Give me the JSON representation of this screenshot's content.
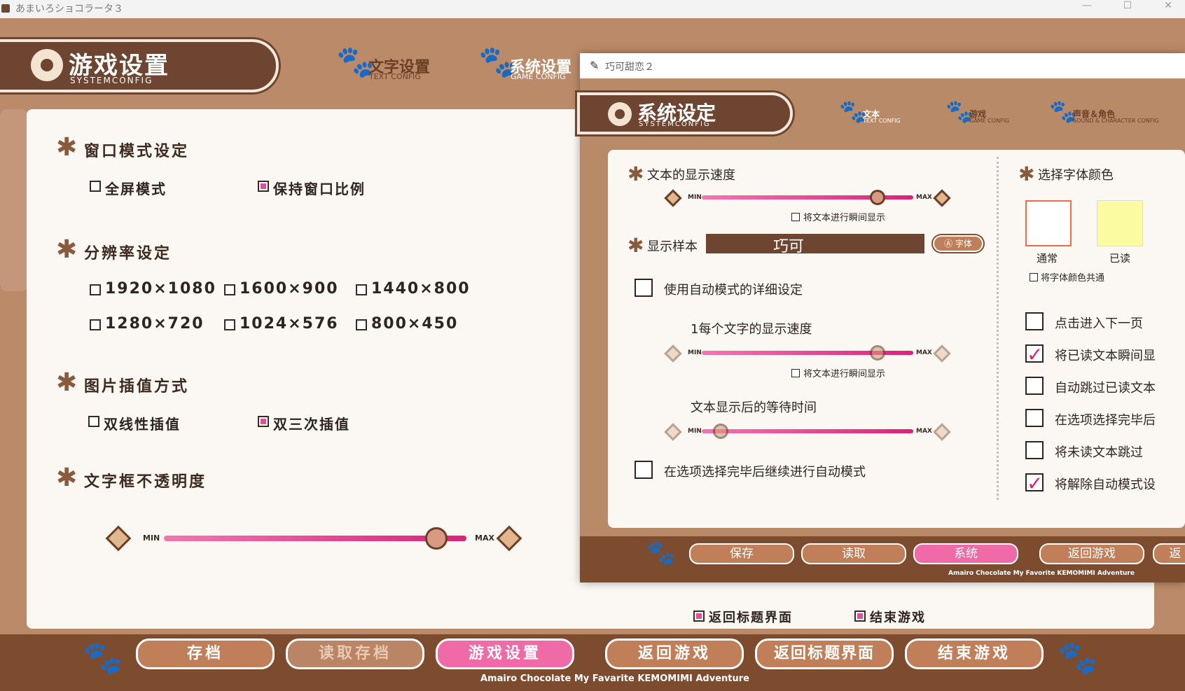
{
  "window": {
    "title": "あまいろショコラータ３",
    "min": "—",
    "max": "☐",
    "close": "✕"
  },
  "header": {
    "title": "游戏设置",
    "subtitle": "SYSTEMCONFIG",
    "tabs": [
      {
        "label": "文字设置",
        "sub": "TEXT CONFIG"
      },
      {
        "label": "系统设置",
        "sub": "GAME CONFIG"
      }
    ]
  },
  "sections": {
    "window_mode": {
      "title": "窗口模式设定",
      "options": [
        "全屏模式",
        "保持窗口比例"
      ],
      "selected": 1
    },
    "resolution": {
      "title": "分辨率设定",
      "options": [
        "1920×1080",
        "1600×900",
        "1440×800",
        "1280×720",
        "1024×576",
        "800×450"
      ]
    },
    "interpolation": {
      "title": "图片插值方式",
      "options": [
        "双线性插值",
        "双三次插值"
      ],
      "selected": 1
    },
    "opacity": {
      "title": "文字框不透明度",
      "min": "MIN",
      "max": "MAX",
      "value": 0.9
    }
  },
  "hidden_options": {
    "return_title": "返回标题界面",
    "end_game": "结束游戏"
  },
  "bottom": {
    "buttons": [
      "存档",
      "读取存档",
      "游戏设置",
      "返回游戏",
      "返回标题界面",
      "结束游戏"
    ],
    "footer": "Amairo Chocolate My Favarite KEMOMIMI Adventure"
  },
  "overlay": {
    "title": "巧可甜恋２",
    "header": {
      "title": "系统设定",
      "subtitle": "SYSTEMCONFIG"
    },
    "tabs": [
      {
        "label": "文本",
        "sub": "TEXT CONFIG"
      },
      {
        "label": "游戏",
        "sub": "GAME CONFIG"
      },
      {
        "label": "声音＆角色",
        "sub": "SOUND & CHARACTER CONFIG"
      }
    ],
    "text_speed": {
      "title": "文本的显示速度",
      "min": "MIN",
      "max": "MAX",
      "value": 0.83,
      "instant": "将文本进行瞬间显示"
    },
    "sample": {
      "title": "显示样本",
      "text": "巧可",
      "font_button": "Ⓐ 字体"
    },
    "auto_detail": "使用自动模式的详细设定",
    "auto_speed": {
      "title": "1每个文字的显示速度",
      "min": "MIN",
      "max": "MAX",
      "value": 0.83,
      "instant": "将文本进行瞬间显示"
    },
    "wait_time": {
      "title": "文本显示后的等待时间",
      "min": "MIN",
      "max": "MAX",
      "value": 0.09
    },
    "continue_auto": "在选项选择完毕后继续进行自动模式",
    "font_color": {
      "title": "选择字体颜色",
      "normal": "通常",
      "read": "已读",
      "share": "将字体颜色共通"
    },
    "right_options": [
      {
        "label": "点击进入下一页",
        "checked": false
      },
      {
        "label": "将已读文本瞬间显",
        "checked": true
      },
      {
        "label": "自动跳过已读文本",
        "checked": false
      },
      {
        "label": "在选项选择完毕后",
        "checked": false
      },
      {
        "label": "将未读文本跳过",
        "checked": false
      },
      {
        "label": "将解除自动模式设",
        "checked": true
      }
    ],
    "buttons": [
      "保存",
      "读取",
      "系统",
      "返回游戏",
      "返"
    ],
    "footer": "Amairo Chocolate My Favorite KEMOMIMI Adventure"
  },
  "colors": {
    "brown": "#6e4530",
    "pink": "#f06aa7",
    "panel": "#fbf7f3"
  }
}
